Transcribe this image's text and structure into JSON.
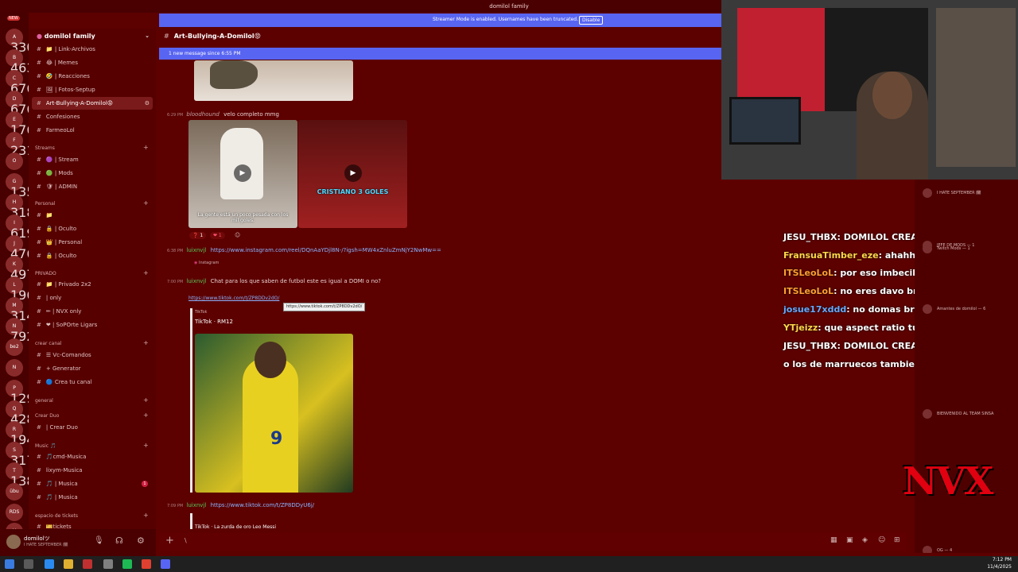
{
  "window": {
    "title": "domilol family"
  },
  "rail": {
    "top_label": "NEW",
    "items": [
      {
        "label": "A",
        "badge": "3308"
      },
      {
        "label": "B",
        "badge": "463"
      },
      {
        "label": "C",
        "badge": "676"
      },
      {
        "label": "D",
        "badge": "676"
      },
      {
        "label": "E",
        "badge": "176"
      },
      {
        "label": "F",
        "badge": "231"
      },
      {
        "label": "O",
        "badge": ""
      },
      {
        "label": "G",
        "badge": "135"
      },
      {
        "label": "H",
        "badge": "318"
      },
      {
        "label": "I",
        "badge": "619"
      },
      {
        "label": "J",
        "badge": "476"
      },
      {
        "label": "K",
        "badge": "497"
      },
      {
        "label": "L",
        "badge": "196"
      },
      {
        "label": "M",
        "badge": "314"
      },
      {
        "label": "N",
        "badge": "792"
      },
      {
        "label": "be2",
        "badge": ""
      },
      {
        "label": "N",
        "badge": ""
      },
      {
        "label": "P",
        "badge": "129"
      },
      {
        "label": "Q",
        "badge": "428"
      },
      {
        "label": "R",
        "badge": "194"
      },
      {
        "label": "S",
        "badge": "317"
      },
      {
        "label": "T",
        "badge": "138"
      },
      {
        "label": "übu",
        "badge": ""
      },
      {
        "label": "RDS",
        "badge": ""
      },
      {
        "label": "U",
        "badge": "NEW"
      }
    ]
  },
  "sidebar": {
    "server_name": "domilol family",
    "categories": [
      {
        "name": "Streams"
      },
      {
        "name": "Personal"
      },
      {
        "name": "PRIVADO"
      },
      {
        "name": "crear canal"
      },
      {
        "name": "general"
      },
      {
        "name": "Crear Duo"
      },
      {
        "name": "Music 🎵"
      },
      {
        "name": "espacio de tickets"
      }
    ],
    "channels": [
      {
        "label": "📁 | Link-Archivos"
      },
      {
        "label": "😂 | Memes"
      },
      {
        "label": "🤣 | Reacciones"
      },
      {
        "label": "🖼 | Fotos-Septup"
      },
      {
        "label": "Art-Bullying-A-Domilol😡"
      },
      {
        "label": "Confesiones"
      },
      {
        "label": "FarmeoLol"
      },
      {
        "label": "🟣 | Stream"
      },
      {
        "label": "🟢 | Mods"
      },
      {
        "label": "🛡 | ADMIN"
      },
      {
        "label": "📁"
      },
      {
        "label": "🔒 | Oculto"
      },
      {
        "label": "👑 | Personal"
      },
      {
        "label": "🔒 | Oculto"
      },
      {
        "label": "📁 | Privado 2x2"
      },
      {
        "label": "| only"
      },
      {
        "label": "✏ | NVX only"
      },
      {
        "label": "❤ | SoPOrte Ligars"
      },
      {
        "label": "☰ Vc-Comandos"
      },
      {
        "label": "+ Generator"
      },
      {
        "label": "🔵 Crea tu canal"
      },
      {
        "label": "| Crear Duo"
      },
      {
        "label": "🎵cmd-Musica"
      },
      {
        "label": "lixym-Musica"
      },
      {
        "label": "🎵 | Musica"
      },
      {
        "label": "🎵 | Musica"
      },
      {
        "label": "🎫tickets"
      }
    ],
    "unread_ping": "1"
  },
  "user": {
    "name": "domilolツ",
    "status": "I HATE SEPTEMBER 🗓"
  },
  "banner": {
    "text": "Streamer Mode is enabled. Usernames have been truncated.",
    "disable": "Disable"
  },
  "channel": {
    "name": "Art-Bullying-A-Domilol😡"
  },
  "new_messages": "1 new message since 6:55 PM",
  "messages": [
    {
      "time": "6:29 PM",
      "user": "bloodhound",
      "text": "velo completo mmg"
    },
    {
      "time": "6:38 PM",
      "user": "luixnvjl",
      "link": "https://www.instagram.com/reel/DQnAaYDjl8N-/?igsh=MW4xZnluZmNjY2NwMw=="
    },
    {
      "time": "7:00 PM",
      "user": "luixnvjl",
      "text": "Chat para los que saben de futbol este es igual a DOMI o no?"
    },
    {
      "time": "7:09 PM",
      "user": "luixnvjl",
      "link": "https://www.tiktok.com/t/ZP8DDyU6j/"
    }
  ],
  "reactions": {
    "a": "❓ 1",
    "b": "❤ 1"
  },
  "thumb_text": {
    "left": "La gente está un poco pesada con los mil goles.",
    "right": "CRISTIANO 3 GOLES"
  },
  "instagram_label": "Instagram",
  "tiktok": {
    "link": "https://www.tiktok.com/t/ZP8DDv2dO/",
    "tooltip": "https://www.tiktok.com/t/ZP8DDv2dO/",
    "provider": "TikTok",
    "title": "TikTok · RM12",
    "next_title": "TikTok · La zurda de oro Leo Messi"
  },
  "stream_overlay": {
    "lines": [
      {
        "user": "JESU_THBX",
        "text": ": DOMILOL CREA LA SELECCIÓN DOMIN",
        "color": "#ffffff"
      },
      {
        "user": "FransuaTimber_eze",
        "text": ": ahahhaha",
        "color": "#ffd84a"
      },
      {
        "user": "ITSLeoLoL",
        "text": ": por eso imbecil yo que te estoy hablan",
        "color": "#ffa030"
      },
      {
        "user": "ITSLeoLoL",
        "text": ": no eres davo bro",
        "color": "#ffa030"
      },
      {
        "user": "josue17xddd",
        "text": ": no domas bro",
        "color": "#66aaff"
      },
      {
        "user": "YTjeizz",
        "text": ": que aspect ratio tu usas en fivem",
        "color": "#ffd84a"
      },
      {
        "user": "JESU_THBX",
        "text": ": DOMILOL CREA LA SELECCIÓN DOMIN",
        "color": "#ffffff"
      },
      {
        "user": "",
        "text": "o los de marruecos tambien los de francias,inglaterra",
        "color": "#ffffff"
      }
    ],
    "logo": "NVX"
  },
  "side_chat": {
    "entries": [
      "I HATE SEPTEMBER 🗓",
      "JEFE DE MODS — 1",
      "Twitch Mods — 1",
      "Amantes de domilol — 6",
      "BIENVENIDO AL TEAM SINSA",
      "OG — 4"
    ]
  },
  "taskbar": {
    "time": "7:12 PM",
    "date": "11/4/2025"
  }
}
